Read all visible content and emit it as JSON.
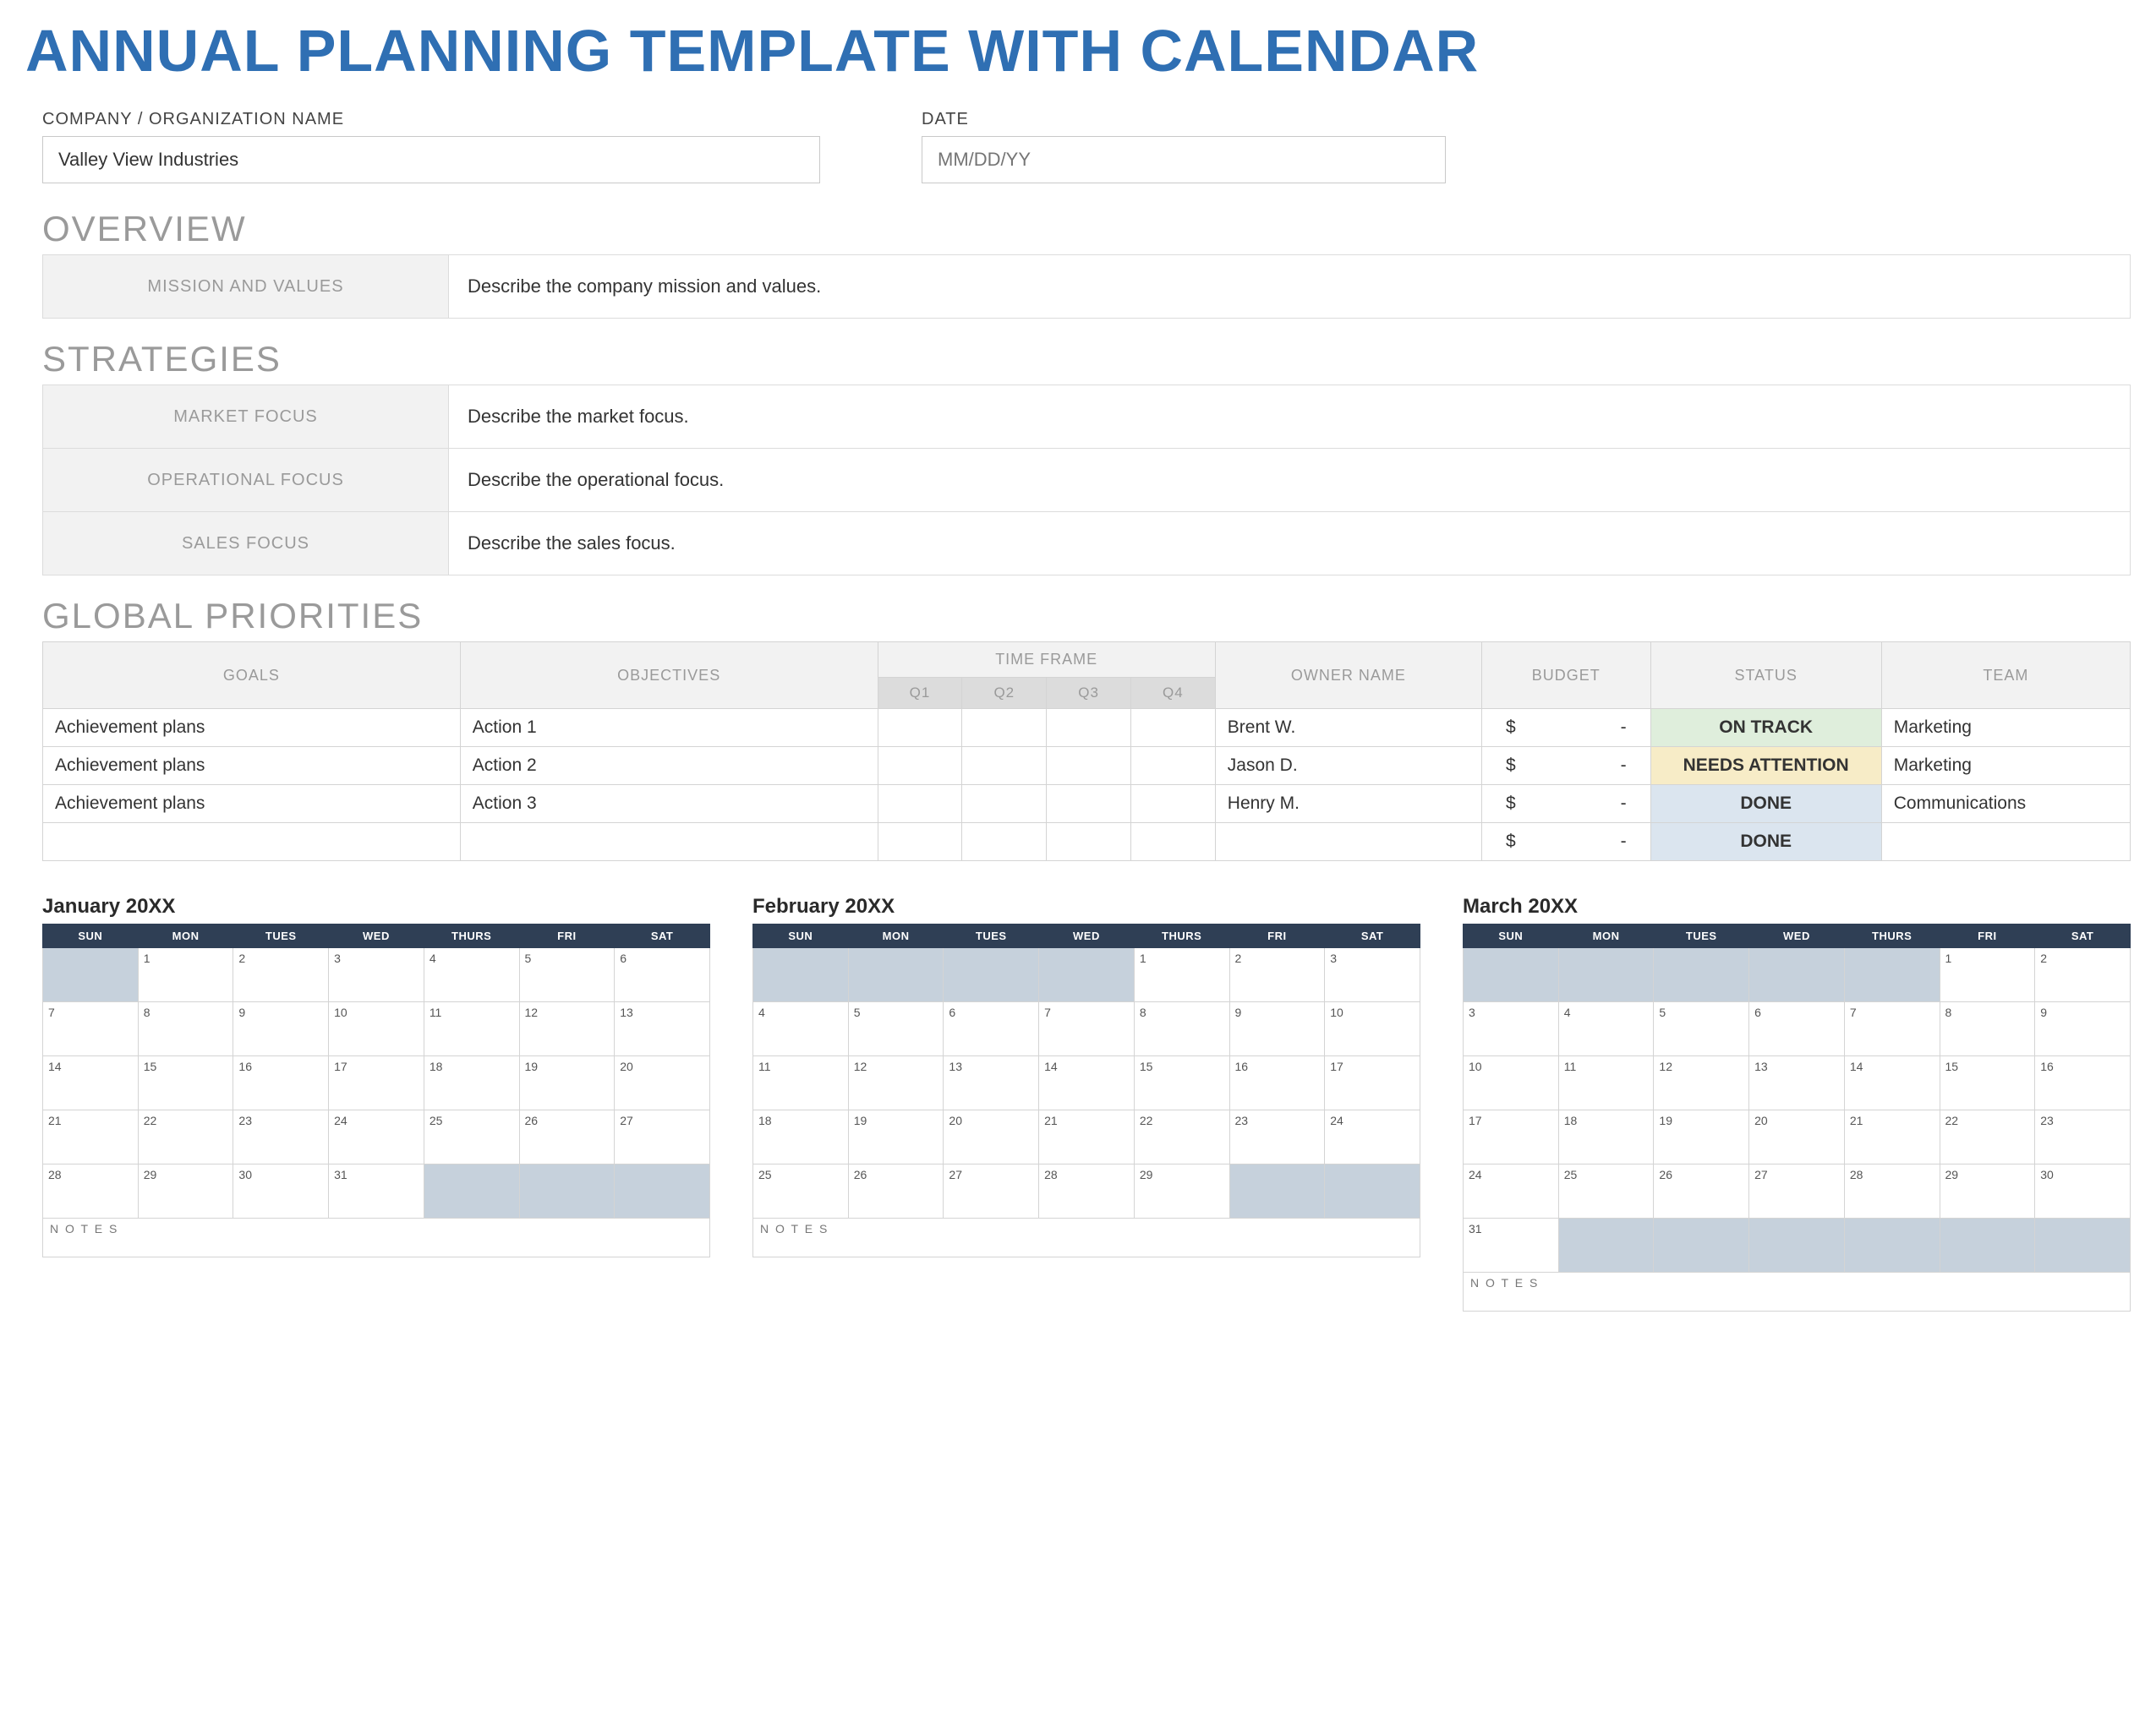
{
  "title": "ANNUAL PLANNING TEMPLATE WITH CALENDAR",
  "meta": {
    "company_label": "COMPANY / ORGANIZATION NAME",
    "company_value": "Valley View Industries",
    "date_label": "DATE",
    "date_placeholder": "MM/DD/YY"
  },
  "overview": {
    "heading": "OVERVIEW",
    "rows": [
      {
        "label": "MISSION AND VALUES",
        "text": "Describe the company mission and values."
      }
    ]
  },
  "strategies": {
    "heading": "STRATEGIES",
    "rows": [
      {
        "label": "MARKET FOCUS",
        "text": "Describe the market focus."
      },
      {
        "label": "OPERATIONAL FOCUS",
        "text": "Describe the operational focus."
      },
      {
        "label": "SALES FOCUS",
        "text": "Describe the sales focus."
      }
    ]
  },
  "global_priorities": {
    "heading": "GLOBAL PRIORITIES",
    "headers": {
      "goals": "GOALS",
      "objectives": "OBJECTIVES",
      "time_frame": "TIME FRAME",
      "q1": "Q1",
      "q2": "Q2",
      "q3": "Q3",
      "q4": "Q4",
      "owner": "OWNER NAME",
      "budget": "BUDGET",
      "status": "STATUS",
      "team": "TEAM"
    },
    "rows": [
      {
        "goal": "Achievement plans",
        "objective": "Action 1",
        "owner": "Brent W.",
        "budget_sym": "$",
        "budget_val": "-",
        "status": "ON TRACK",
        "status_class": "st-ontrack",
        "team": "Marketing"
      },
      {
        "goal": "Achievement plans",
        "objective": "Action 2",
        "owner": "Jason D.",
        "budget_sym": "$",
        "budget_val": "-",
        "status": "NEEDS ATTENTION",
        "status_class": "st-needs",
        "team": "Marketing"
      },
      {
        "goal": "Achievement plans",
        "objective": "Action 3",
        "owner": "Henry M.",
        "budget_sym": "$",
        "budget_val": "-",
        "status": "DONE",
        "status_class": "st-done",
        "team": "Communications"
      },
      {
        "goal": "",
        "objective": "",
        "owner": "",
        "budget_sym": "$",
        "budget_val": "-",
        "status": "DONE",
        "status_class": "st-done",
        "team": ""
      }
    ]
  },
  "calendars": [
    {
      "title": "January 20XX",
      "day_headers": [
        "SUN",
        "MON",
        "TUES",
        "WED",
        "THURS",
        "FRI",
        "SAT"
      ],
      "lead_pad": 1,
      "days": 31,
      "trail_pad": 3,
      "notes_label": "N O T E S"
    },
    {
      "title": "February 20XX",
      "day_headers": [
        "SUN",
        "MON",
        "TUES",
        "WED",
        "THURS",
        "FRI",
        "SAT"
      ],
      "lead_pad": 4,
      "days": 29,
      "trail_pad": 2,
      "notes_label": "N O T E S"
    },
    {
      "title": "March 20XX",
      "day_headers": [
        "SUN",
        "MON",
        "TUES",
        "WED",
        "THURS",
        "FRI",
        "SAT"
      ],
      "lead_pad": 5,
      "days": 31,
      "trail_pad": 6,
      "notes_label": "N O T E S"
    }
  ]
}
